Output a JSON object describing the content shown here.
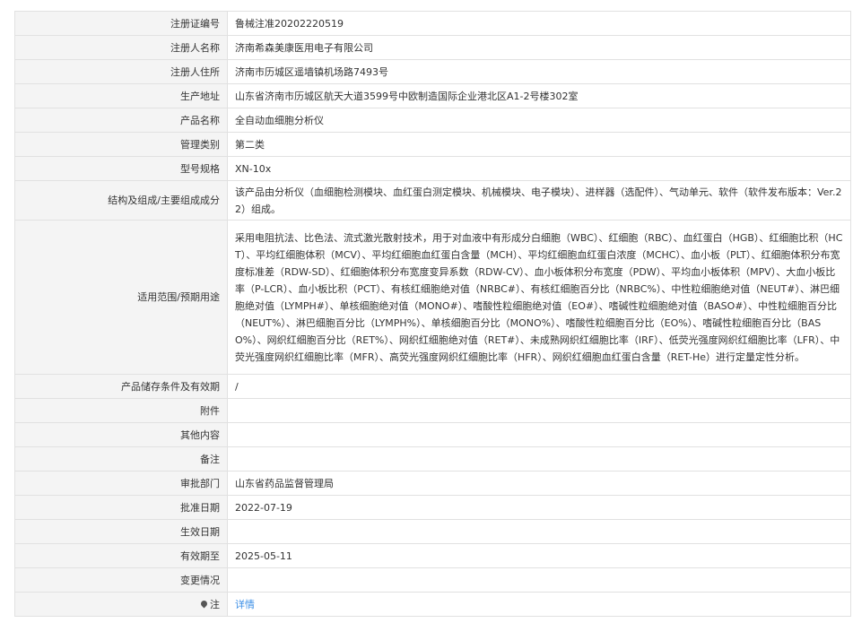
{
  "rows": [
    {
      "label": "注册证编号",
      "value": "鲁械注准20202220519"
    },
    {
      "label": "注册人名称",
      "value": "济南希森美康医用电子有限公司"
    },
    {
      "label": "注册人住所",
      "value": "济南市历城区遥墙镇机场路7493号"
    },
    {
      "label": "生产地址",
      "value": "山东省济南市历城区航天大道3599号中欧制造国际企业港北区A1-2号楼302室"
    },
    {
      "label": "产品名称",
      "value": "全自动血细胞分析仪"
    },
    {
      "label": "管理类别",
      "value": "第二类"
    },
    {
      "label": "型号规格",
      "value": "XN-10x"
    },
    {
      "label": "结构及组成/主要组成成分",
      "value": "该产品由分析仪（血细胞检测模块、血红蛋白测定模块、机械模块、电子模块）、进样器（选配件）、气动单元、软件（软件发布版本：Ver.22）组成。"
    },
    {
      "label": "适用范围/预期用途",
      "value": "采用电阻抗法、比色法、流式激光散射技术，用于对血液中有形成分白细胞（WBC）、红细胞（RBC）、血红蛋白（HGB）、红细胞比积（HCT）、平均红细胞体积（MCV）、平均红细胞血红蛋白含量（MCH）、平均红细胞血红蛋白浓度（MCHC）、血小板（PLT）、红细胞体积分布宽度标准差（RDW-SD）、红细胞体积分布宽度变异系数（RDW-CV）、血小板体积分布宽度（PDW）、平均血小板体积（MPV）、大血小板比率（P-LCR）、血小板比积（PCT）、有核红细胞绝对值（NRBC#）、有核红细胞百分比（NRBC%）、中性粒细胞绝对值（NEUT#）、淋巴细胞绝对值（LYMPH#）、单核细胞绝对值（MONO#）、嗜酸性粒细胞绝对值（EO#）、嗜碱性粒细胞绝对值（BASO#）、中性粒细胞百分比（NEUT%）、淋巴细胞百分比（LYMPH%）、单核细胞百分比（MONO%）、嗜酸性粒细胞百分比（EO%）、嗜碱性粒细胞百分比（BASO%）、网织红细胞百分比（RET%）、网织红细胞绝对值（RET#）、未成熟网织红细胞比率（IRF）、低荧光强度网织红细胞比率（LFR）、中荧光强度网织红细胞比率（MFR）、高荧光强度网织红细胞比率（HFR）、网织红细胞血红蛋白含量（RET-He）进行定量定性分析。"
    },
    {
      "label": "产品储存条件及有效期",
      "value": "/"
    },
    {
      "label": "附件",
      "value": ""
    },
    {
      "label": "其他内容",
      "value": ""
    },
    {
      "label": "备注",
      "value": ""
    },
    {
      "label": "审批部门",
      "value": "山东省药品监督管理局"
    },
    {
      "label": "批准日期",
      "value": "2022-07-19"
    },
    {
      "label": "生效日期",
      "value": ""
    },
    {
      "label": "有效期至",
      "value": "2025-05-11"
    },
    {
      "label": "变更情况",
      "value": ""
    }
  ],
  "note": {
    "label": "注",
    "icon": "pin-icon",
    "link_text": "详情"
  }
}
